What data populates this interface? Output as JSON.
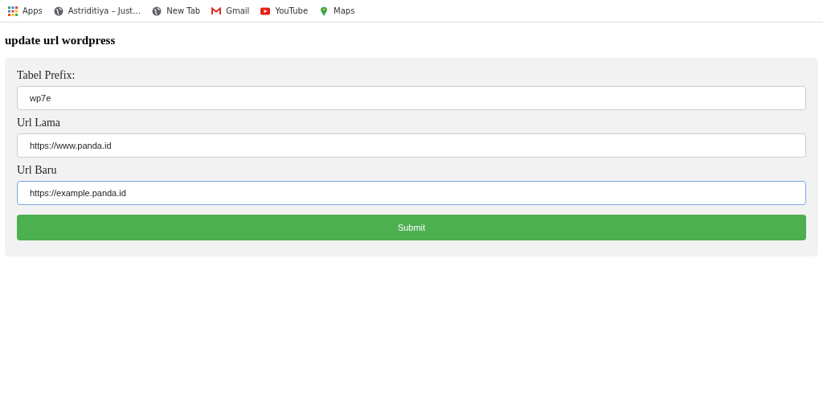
{
  "bookmarks": [
    {
      "label": "Apps",
      "kind": "apps"
    },
    {
      "label": "Astriditiya – Just…",
      "kind": "globe"
    },
    {
      "label": "New Tab",
      "kind": "globe"
    },
    {
      "label": "Gmail",
      "kind": "mail"
    },
    {
      "label": "YouTube",
      "kind": "video"
    },
    {
      "label": "Maps",
      "kind": "pin"
    }
  ],
  "heading": "update url wordpress",
  "fields": [
    {
      "label": "Tabel Prefix:",
      "value": "wp7e",
      "focused": false
    },
    {
      "label": "Url Lama",
      "value": "https://www.panda.id",
      "focused": false
    },
    {
      "label": "Url Baru",
      "value": "https://example.panda.id",
      "focused": true
    }
  ],
  "submit": "Submit"
}
